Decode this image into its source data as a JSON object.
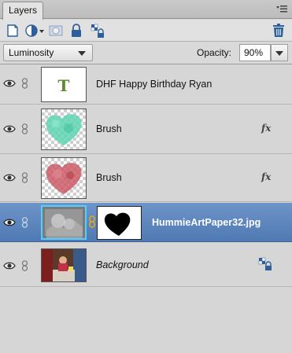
{
  "panel": {
    "tab_label": "Layers"
  },
  "toolbar": {
    "buttons": [
      "new-layer-icon",
      "adjustment-layer-icon",
      "add-mask-icon",
      "lock-all-icon",
      "lock-transparency-icon",
      "trash-icon"
    ]
  },
  "blend": {
    "mode": "Luminosity",
    "opacity_label": "Opacity:",
    "opacity_value": "90%"
  },
  "layers": [
    {
      "name": "DHF Happy Birthday Ryan",
      "type": "text",
      "visible": true,
      "fx": false,
      "selected": false
    },
    {
      "name": "Brush",
      "type": "brush",
      "color": "#5fd6b3",
      "visible": true,
      "fx": true,
      "fx_label": "fx",
      "selected": false
    },
    {
      "name": "Brush",
      "type": "brush",
      "color": "#c9525f",
      "visible": true,
      "fx": true,
      "fx_label": "fx",
      "selected": false
    },
    {
      "name": "HummieArtPaper32.jpg",
      "type": "image-with-mask",
      "visible": true,
      "fx": false,
      "selected": true
    },
    {
      "name": "Background",
      "type": "background",
      "visible": true,
      "fx": false,
      "locked": true,
      "selected": false
    }
  ],
  "colors": {
    "selection": "#5a84bd",
    "text_layer_glyph": "#5e8a2e"
  }
}
